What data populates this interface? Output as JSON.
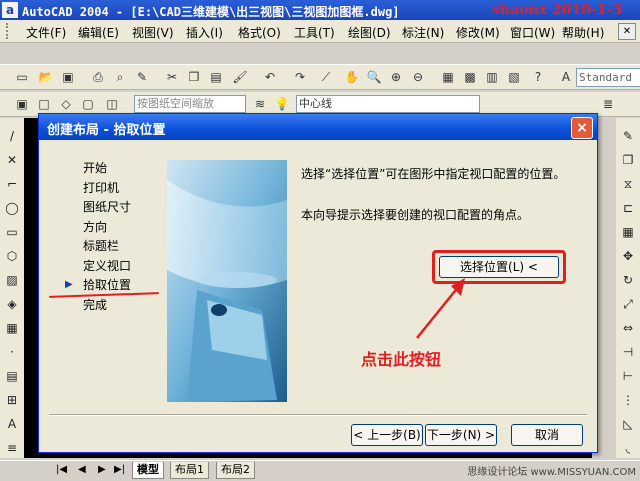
{
  "window": {
    "title": "AutoCAD 2004 - [E:\\CAD三维建模\\出三视图\\三视图加图框.dwg]",
    "watermark": "shaonx 2010-1-3"
  },
  "menu": [
    "文件(F)",
    "编辑(E)",
    "视图(V)",
    "插入(I)",
    "格式(O)",
    "工具(T)",
    "绘图(D)",
    "标注(N)",
    "修改(M)",
    "窗口(W)",
    "帮助(H)"
  ],
  "toolbar": {
    "text_style": "Standard",
    "viewport_scale": "按图纸空间缩放",
    "layer": "中心线"
  },
  "dialog": {
    "title": "创建布局 - 拾取位置",
    "close": "×",
    "steps": [
      "开始",
      "打印机",
      "图纸尺寸",
      "方向",
      "标题栏",
      "定义视口",
      "拾取位置",
      "完成"
    ],
    "current_step": "拾取位置",
    "marker": "▶",
    "description1": "选择“选择位置”可在图形中指定视口配置的位置。",
    "description2": "本向导提示选择要创建的视口配置的角点。",
    "pick_button": "选择位置(L) <",
    "annotation": "点击此按钮",
    "back": "< 上一步(B)",
    "next": "下一步(N) >",
    "cancel": "取消"
  },
  "tabs": [
    "模型",
    "布局1",
    "布局2"
  ],
  "active_tab": "模型",
  "credit": "思缘设计论坛 www.MISSYUAN.COM"
}
